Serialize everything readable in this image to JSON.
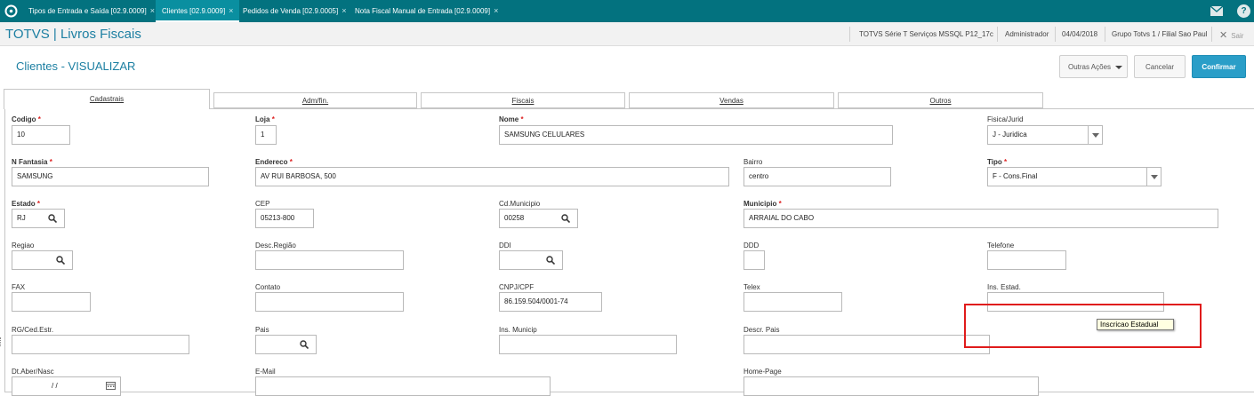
{
  "topbar": {
    "tabs": [
      {
        "label": "Tipos de Entrada e Saída [02.9.0009]",
        "close": "×"
      },
      {
        "label": "Clientes [02.9.0009]",
        "close": "×"
      },
      {
        "label": "Pedidos de Venda [02.9.0005]",
        "close": "×"
      },
      {
        "label": "Nota Fiscal Manual de Entrada [02.9.0009]",
        "close": "×"
      }
    ],
    "active_tab": 1,
    "icons": [
      "totvs-logo-icon",
      "mail-icon",
      "help-icon"
    ],
    "help_glyph": "?"
  },
  "header": {
    "app_title": "TOTVS | Livros Fiscais",
    "environment": "TOTVS Série T Serviços MSSQL P12_17c",
    "user": "Administrador",
    "date": "04/04/2018",
    "branch": "Grupo Totvs 1 / Filial Sao Paul",
    "logout_glyph": "✕",
    "logout_label": "Sair"
  },
  "page": {
    "title": "Clientes - VISUALIZAR",
    "buttons": {
      "other_actions": "Outras Ações",
      "cancel": "Cancelar",
      "confirm": "Confirmar"
    }
  },
  "folder_tabs": [
    "Cadastrais",
    "Adm/fin.",
    "Fiscais",
    "Vendas",
    "Outros"
  ],
  "form": {
    "codigo": {
      "label": "Codigo",
      "value": "10"
    },
    "loja": {
      "label": "Loja",
      "value": "1"
    },
    "nome": {
      "label": "Nome",
      "value": "SAMSUNG CELULARES"
    },
    "fisica_jurid": {
      "label": "Fisica/Jurid",
      "value": "J - Juridica"
    },
    "n_fantasia": {
      "label": "N Fantasia",
      "value": "SAMSUNG"
    },
    "endereco": {
      "label": "Endereco",
      "value": "AV RUI BARBOSA, 500"
    },
    "bairro": {
      "label": "Bairro",
      "value": "centro"
    },
    "tipo": {
      "label": "Tipo",
      "value": "F - Cons.Final"
    },
    "estado": {
      "label": "Estado",
      "value": "RJ"
    },
    "cep": {
      "label": "CEP",
      "value": "05213-800"
    },
    "cd_municipio": {
      "label": "Cd.Municipio",
      "value": "00258"
    },
    "municipio": {
      "label": "Municipio",
      "value": "ARRAIAL DO CABO"
    },
    "regiao": {
      "label": "Regiao",
      "value": ""
    },
    "desc_regiao": {
      "label": "Desc.Região",
      "value": ""
    },
    "ddi": {
      "label": "DDI",
      "value": ""
    },
    "ddd": {
      "label": "DDD",
      "value": ""
    },
    "telefone": {
      "label": "Telefone",
      "value": ""
    },
    "fax": {
      "label": "FAX",
      "value": ""
    },
    "contato": {
      "label": "Contato",
      "value": ""
    },
    "cnpj_cpf": {
      "label": "CNPJ/CPF",
      "value": "86.159.504/0001-74"
    },
    "telex": {
      "label": "Telex",
      "value": ""
    },
    "ins_estad": {
      "label": "Ins. Estad.",
      "value": ""
    },
    "rg_ced": {
      "label": "RG/Ced.Estr.",
      "value": ""
    },
    "pais": {
      "label": "Pais",
      "value": ""
    },
    "ins_municip": {
      "label": "Ins. Municip",
      "value": ""
    },
    "descr_pais": {
      "label": "Descr. Pais",
      "value": ""
    },
    "dt_aber": {
      "label": "Dt.Aber/Nasc",
      "value": "/ /"
    },
    "email": {
      "label": "E-Mail",
      "value": ""
    },
    "home_page": {
      "label": "Home-Page",
      "value": ""
    },
    "required_mark": "*"
  },
  "tooltip": {
    "text": "Inscricao Estadual"
  },
  "colors": {
    "topbar": "#03727f",
    "accent": "#1c7fa2",
    "confirm": "#2a9ec8",
    "required": "#d22222",
    "highlight_box": "#e01b1b",
    "tooltip_bg": "#ffffe1"
  }
}
